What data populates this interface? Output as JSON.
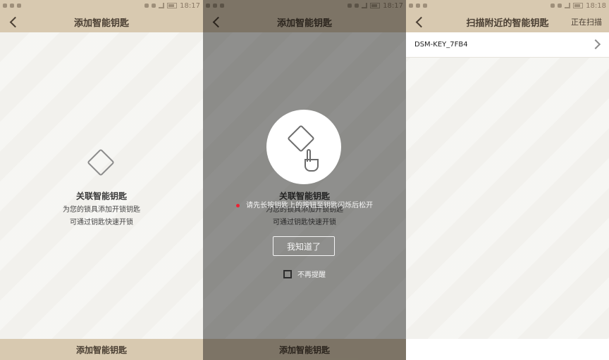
{
  "status": {
    "time1": "18:17",
    "time2": "18:17",
    "time3": "18:18"
  },
  "screens": {
    "add_key": {
      "title": "添加智能钥匙",
      "heading": "关联智能钥匙",
      "line1": "为您的锁具添加开锁钥匙",
      "line2": "可通过钥匙快速开锁",
      "bottom_button": "添加智能钥匙"
    },
    "add_key_overlay": {
      "title": "添加智能钥匙",
      "heading": "关联智能钥匙",
      "line1": "为您的锁具添加开锁钥匙",
      "line2": "可通过钥匙快速开锁",
      "tooltip": "请先长按钥匙上的按钮至钥匙闪烁后松开",
      "ok_button": "我知道了",
      "checkbox_label": "不再提醒",
      "bottom_button": "添加智能钥匙"
    },
    "scan": {
      "title": "扫描附近的智能钥匙",
      "right_action": "正在扫描",
      "items": [
        {
          "label": "DSM-KEY_7FB4"
        }
      ]
    }
  },
  "colors": {
    "header": "#d8c9b0",
    "background": "#f2f1ed",
    "text_dark": "#4a3f33",
    "overlay": "rgba(0,0,0,0.42)",
    "accent_red": "#e22233"
  },
  "icons": {
    "back": "chevron-left-icon",
    "key": "diamond-key-icon",
    "touch": "finger-press-icon",
    "chevron": "chevron-right-icon"
  }
}
